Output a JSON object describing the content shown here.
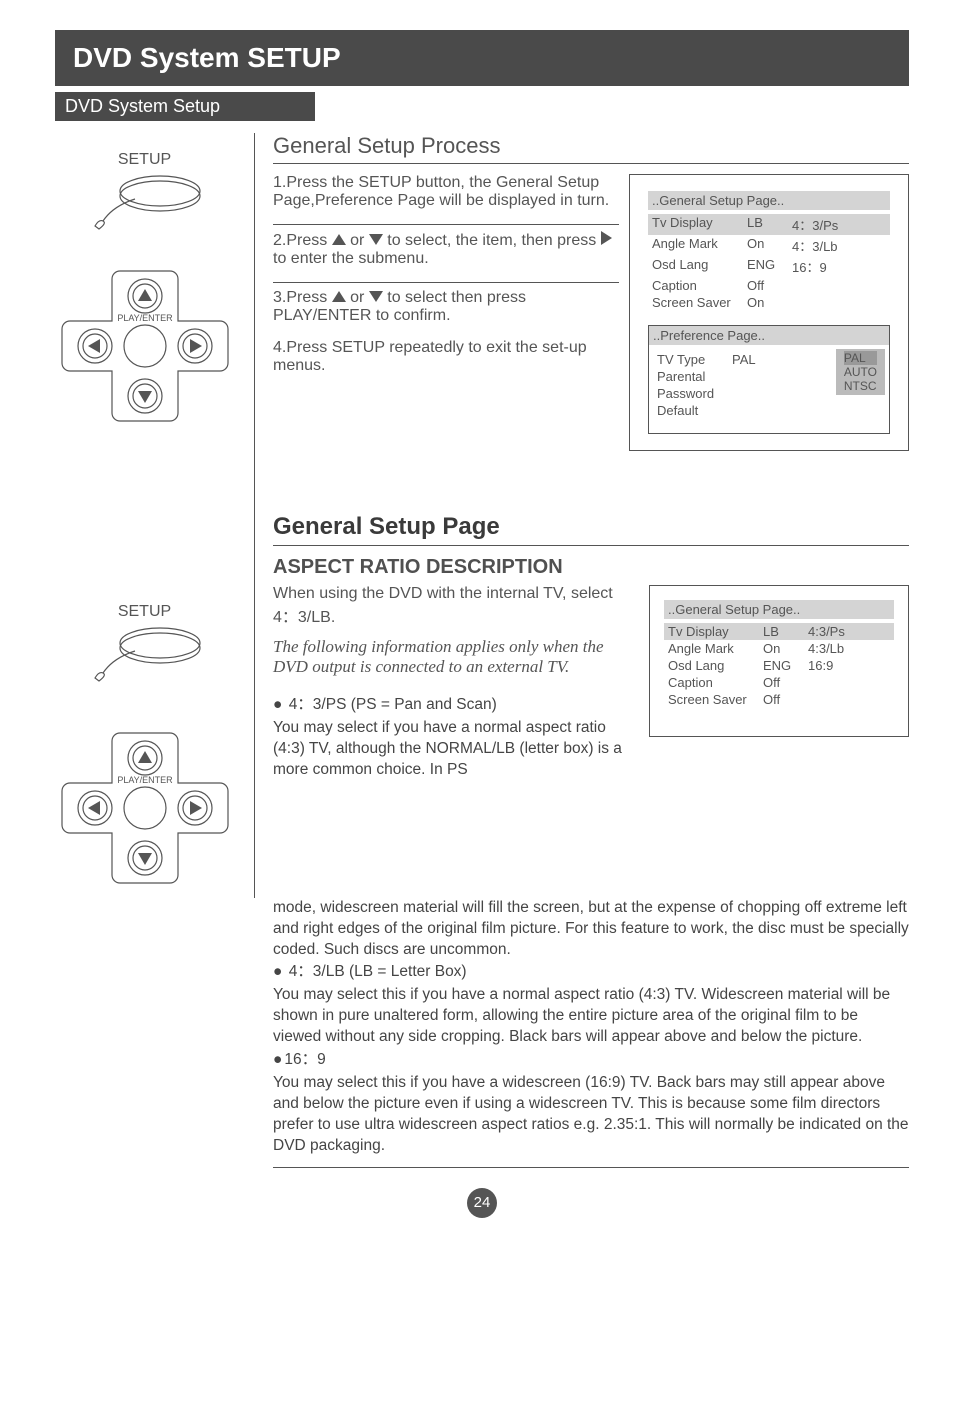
{
  "title_bar": "DVD System SETUP",
  "sub_bar": "DVD System Setup",
  "setup_label": "SETUP",
  "dpad_label": "PLAY/ENTER",
  "general_process_hdr": "General Setup Process",
  "steps": {
    "s1": "1.Press the SETUP button, the General Setup Page,Preference Page  will be displayed in turn.",
    "s2a": "2.Press ",
    "s2b": " or ",
    "s2c": "   to select, the item, then press ",
    "s2d": " to enter the submenu.",
    "s3a": "3.Press ",
    "s3b": " or ",
    "s3c": "  to select  then press PLAY/ENTER to confirm.",
    "s4": "4.Press  SETUP repeatedly  to exit  the  set-up menus."
  },
  "osd1": {
    "hdr": "..General Setup Page..",
    "rows": [
      {
        "c1": "Tv Display",
        "c2": "LB",
        "c3": "4：3/Ps",
        "hl": true
      },
      {
        "c1": "Angle Mark",
        "c2": "On",
        "c3": "4：3/Lb"
      },
      {
        "c1": "Osd Lang",
        "c2": "ENG",
        "c3": "16：9"
      },
      {
        "c1": "Caption",
        "c2": "Off",
        "c3": ""
      },
      {
        "c1": "Screen Saver",
        "c2": "On",
        "c3": ""
      }
    ],
    "pref_hdr": "..Preference Page..",
    "pref_rows": [
      {
        "c1": "TV Type",
        "c2": "PAL"
      },
      {
        "c1": "Parental",
        "c2": ""
      },
      {
        "c1": "Password",
        "c2": ""
      },
      {
        "c1": "Default",
        "c2": ""
      }
    ],
    "popup": [
      "PAL",
      "AUTO",
      "NTSC"
    ]
  },
  "gsp_hdr": "General Setup Page",
  "asp_hdr": "ASPECT RATIO DESCRIPTION",
  "asp_intro": "When using the DVD with the internal TV, select 4：3/LB.",
  "asp_note": "The following information applies only when the DVD output is connected to an external TV.",
  "osd2": {
    "hdr": "..General Setup Page..",
    "rows": [
      {
        "c1": "Tv Display",
        "c2": "LB",
        "c3": "4:3/Ps",
        "hl": true
      },
      {
        "c1": "Angle Mark",
        "c2": "On",
        "c3": "4:3/Lb"
      },
      {
        "c1": "Osd Lang",
        "c2": "ENG",
        "c3": "16:9"
      },
      {
        "c1": "Caption",
        "c2": "Off",
        "c3": ""
      },
      {
        "c1": "Screen Saver",
        "c2": "Off",
        "c3": ""
      }
    ]
  },
  "aspect": {
    "b1_t": "4：3/PS (PS = Pan and Scan)",
    "b1_p": "You may select if you have a normal aspect ratio (4:3) TV, although the NORMAL/LB (letter box) is a more common choice. In PS",
    "b1_cont": "mode, widescreen material will fill the screen, but at the expense of chopping off extreme left and right edges of the original film picture. For this feature to work, the disc must be specially coded. Such discs are uncommon.",
    "b2_t": "4：3/LB (LB = Letter Box)",
    "b2_p": "You may select this if you have a normal aspect ratio (4:3) TV. Widescreen material will be shown in pure unaltered form, allowing the entire picture area of the original film to be viewed without any side cropping. Black bars will appear above and below the picture.",
    "b3_t": "16：9",
    "b3_p": "You may select this if you have a widescreen (16:9) TV. Back bars may still appear above and below the picture even if using a widescreen TV. This is because some film directors prefer to use ultra widescreen aspect ratios e.g. 2.35:1. This will normally be indicated on the DVD packaging."
  },
  "page_num": "24"
}
